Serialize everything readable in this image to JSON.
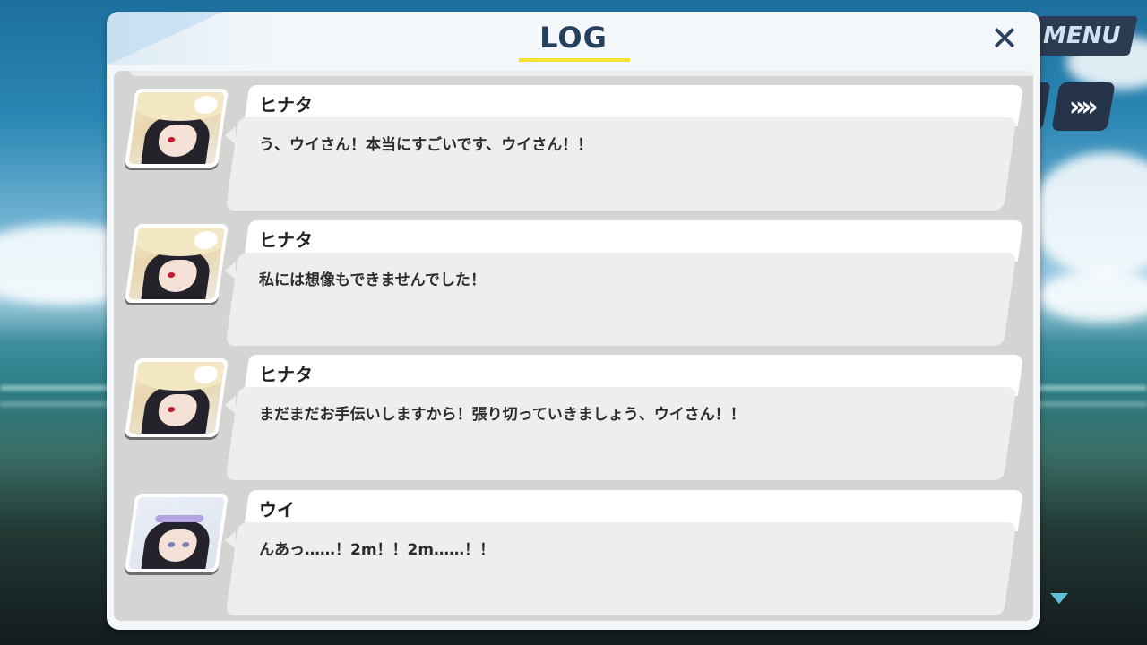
{
  "game_ui": {
    "menu_label": "MENU",
    "skip_label": "»»"
  },
  "log": {
    "title": "LOG",
    "close_label": "✕",
    "entries": [
      {
        "speaker": "ヒナタ",
        "text": "う、ウイさん！本当にすごいです、ウイさん！！"
      },
      {
        "speaker": "ヒナタ",
        "text": "私には想像もできませんでした！"
      },
      {
        "speaker": "ヒナタ",
        "text": "まだまだお手伝いしますから！張り切っていきましょう、ウイさん！！"
      },
      {
        "speaker": "ウイ",
        "text": "んあっ……！2m！！2m……！！"
      }
    ]
  },
  "colors": {
    "accent_underline": "#f4e133",
    "title_text": "#25405e",
    "scroll_arrow": "#5fc1d6"
  },
  "icons": [
    "close-icon",
    "skip-icon",
    "scroll-down-icon"
  ]
}
